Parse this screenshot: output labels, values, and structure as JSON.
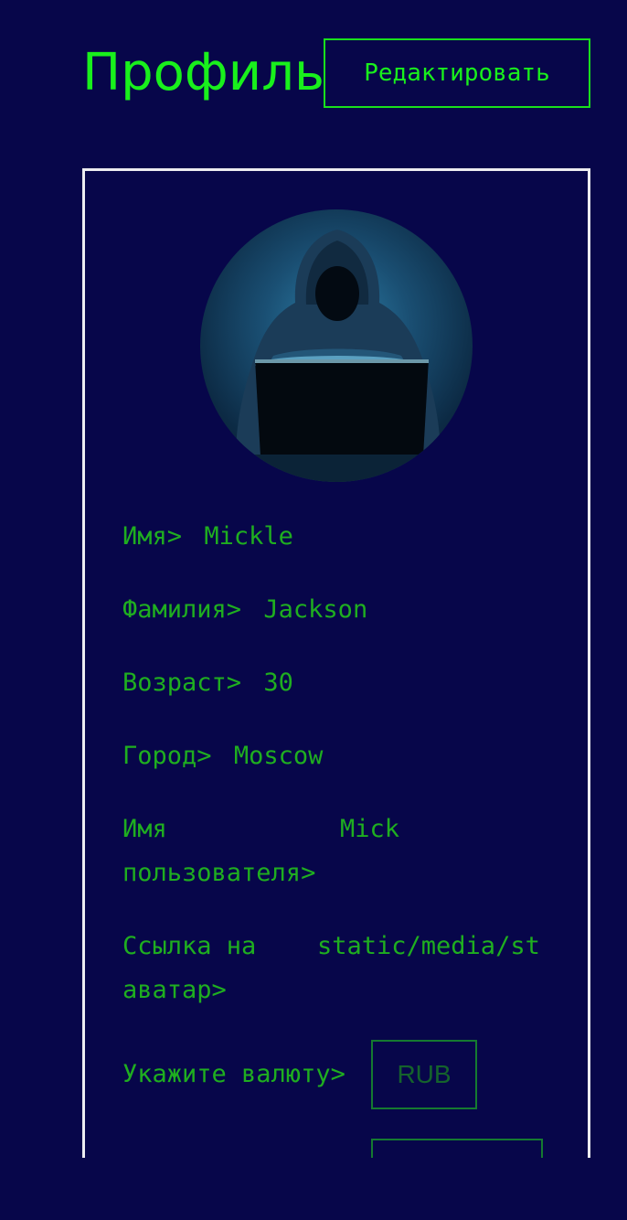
{
  "header": {
    "title": "Профиль",
    "edit_label": "Редактировать"
  },
  "profile": {
    "first_name": {
      "label": "Имя>",
      "value": "Mickle"
    },
    "last_name": {
      "label": "Фамилия>",
      "value": "Jackson"
    },
    "age": {
      "label": "Возраст>",
      "value": "30"
    },
    "city": {
      "label": "Город>",
      "value": "Moscow"
    },
    "username": {
      "label": "Имя\nпользователя>",
      "value": "Mick"
    },
    "avatar_link": {
      "label": "Ссылка на\nаватар>",
      "value": "static/media/st"
    }
  },
  "currency": {
    "label": "Укажите валюту>",
    "placeholder": "RUB"
  },
  "colors": {
    "background": "#07064a",
    "accent": "#19f01c",
    "text": "#1fae20",
    "card_border": "#ececf0",
    "input_border": "#157a30"
  },
  "icons": {
    "avatar": "hooded-hacker-with-laptop"
  }
}
